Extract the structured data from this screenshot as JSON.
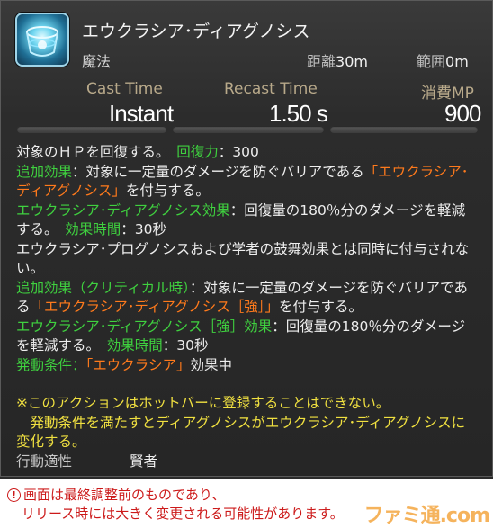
{
  "action": {
    "name": "エウクラシア･ディアグノシス",
    "type": "魔法",
    "range_label": "距離",
    "range_value": "30m",
    "radius_label": "範囲",
    "radius_value": "0m",
    "icon": "eukrasian-diagnosis-icon"
  },
  "stats": {
    "cast_label": "Cast Time",
    "cast_value": "Instant",
    "recast_label": "Recast Time",
    "recast_value": "1.50 s",
    "mp_label": "消費MP",
    "mp_value": "900"
  },
  "description": {
    "l1_a": "対象のＨＰを回復する。",
    "l1_b": "回復力",
    "l1_c": "：300",
    "l2_a": "追加効果",
    "l2_b": "：対象に一定量のダメージを防ぐバリアである",
    "l2_c": "「エウクラシア･ディアグノシス」",
    "l2_d": "を付与する。",
    "l3_a": "エウクラシア･ディアグノシス効果",
    "l3_b": "：回復量の180％分のダメージを軽減する。",
    "l3_c": "効果時間",
    "l3_d": "：30秒",
    "l4": "エウクラシア･プログノシスおよび学者の鼓舞効果とは同時に付与されない。",
    "l5_a": "追加効果（クリティカル時）",
    "l5_b": "：対象に一定量のダメージを防ぐバリアである",
    "l5_c": "「エウクラシア･ディアグノシス［強］」",
    "l5_d": "を付与する。",
    "l6_a": "エウクラシア･ディアグノシス［強］効果",
    "l6_b": "：回復量の180％分のダメージを軽減する。",
    "l6_c": "効果時間",
    "l6_d": "：30秒",
    "l7_a": "発動条件",
    "l7_b": "：",
    "l7_c": "「エウクラシア」",
    "l7_d": "効果中",
    "note1": "※このアクションはホットバーに登録することはできない。",
    "note2": "　発動条件を満たすとディアグノシスがエウクラシア･ディアグノシスに変化する。",
    "job_label": "行動適性",
    "job_value": "賢者"
  },
  "notice": {
    "line1": "画面は最終調整前のものであり、",
    "line2": "リリース時には大きく変更される可能性があります。",
    "watermark": "ファミ通.com"
  },
  "colors": {
    "effect_green": "#3fd13f",
    "status_orange": "#ff7a1c",
    "note_yellow": "#f0e040",
    "notice_red": "#cc1a1a"
  }
}
